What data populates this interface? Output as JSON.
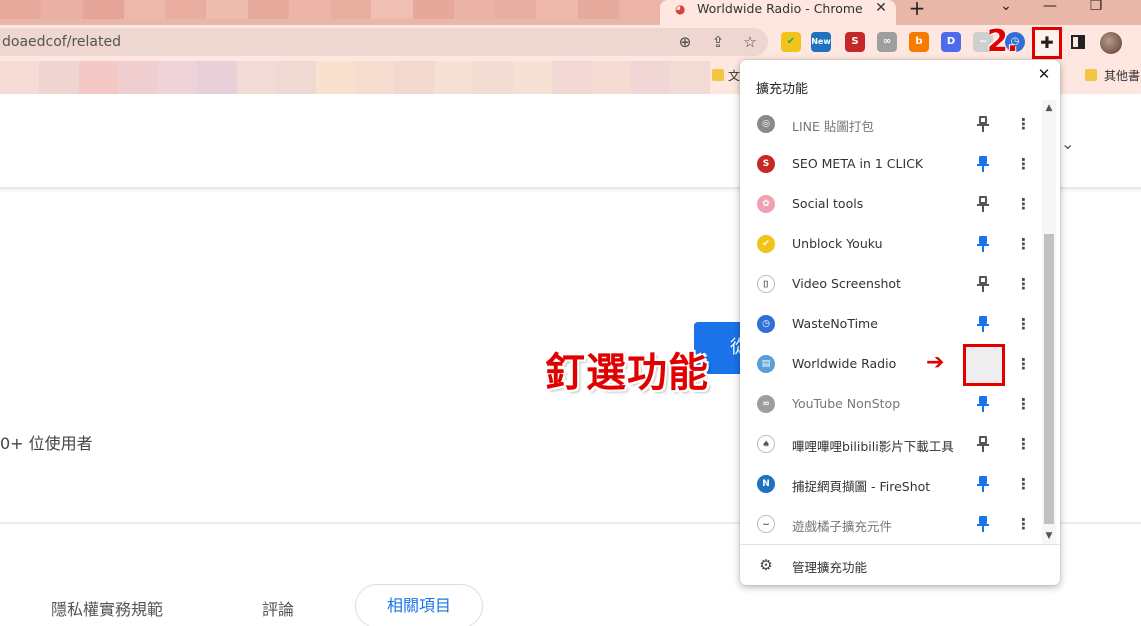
{
  "browser": {
    "active_tab_title": "Worldwide Radio - Chrome 線",
    "url_text": "doaedcof/related",
    "step_label": "2."
  },
  "bookmarks": {
    "folder_label_1": "文",
    "folder_label_2": "其他書"
  },
  "page": {
    "users_text": "0+ 位使用者",
    "blue_button_text": "從",
    "tabs": [
      {
        "label": "隱私權實務規範"
      },
      {
        "label": "評論"
      },
      {
        "label": "相關項目"
      }
    ]
  },
  "annotation": {
    "text": "釘選功能"
  },
  "popup": {
    "title": "擴充功能",
    "extensions": [
      {
        "name": "LINE 貼圖打包",
        "pinned": false,
        "icon": "line-sticker-icon"
      },
      {
        "name": "SEO META in 1 CLICK",
        "pinned": true,
        "icon": "seo-icon"
      },
      {
        "name": "Social tools",
        "pinned": false,
        "icon": "social-tools-icon"
      },
      {
        "name": "Unblock Youku",
        "pinned": true,
        "icon": "unblock-youku-icon"
      },
      {
        "name": "Video Screenshot",
        "pinned": false,
        "icon": "camera-icon"
      },
      {
        "name": "WasteNoTime",
        "pinned": true,
        "icon": "clock-icon"
      },
      {
        "name": "Worldwide Radio",
        "pinned": false,
        "icon": "radio-icon"
      },
      {
        "name": "YouTube NonStop",
        "pinned": true,
        "icon": "infinity-icon"
      },
      {
        "name": "嗶哩嗶哩bilibili影片下載工具",
        "pinned": false,
        "icon": "bilibili-icon"
      },
      {
        "name": "捕捉網頁擷圖 - FireShot",
        "pinned": true,
        "icon": "fireshot-icon"
      },
      {
        "name": "遊戲橘子擴充元件",
        "pinned": true,
        "icon": "gamania-icon"
      }
    ],
    "manage_label": "管理擴充功能"
  },
  "colors": {
    "accent": "#1a73e8",
    "annotation_red": "#e00000"
  }
}
